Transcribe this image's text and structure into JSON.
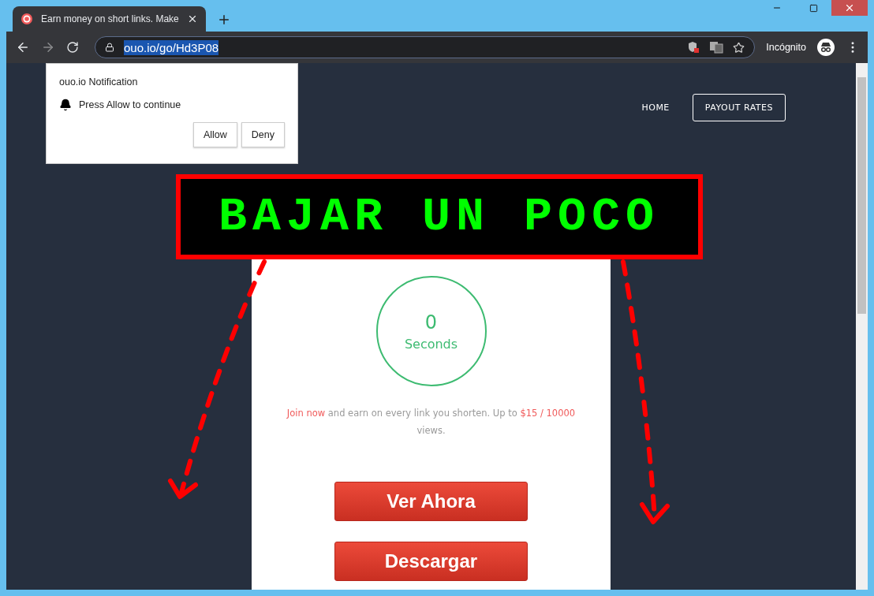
{
  "browser": {
    "tab_title": "Earn money on short links. Make",
    "address": {
      "text": "ouo.io/go/Hd3P08",
      "selected": true
    },
    "profile_label": "Incógnito"
  },
  "notification": {
    "title": "ouo.io Notification",
    "message": "Press Allow to continue",
    "buttons": [
      "Allow",
      "Deny"
    ]
  },
  "nav": [
    {
      "label": "HOME",
      "kind": "link"
    },
    {
      "label": "PAYOUT RATES",
      "kind": "outlined"
    }
  ],
  "banner": {
    "text": "BAJAR UN POCO"
  },
  "timer": {
    "count": "0",
    "unit": "Seconds"
  },
  "promo": [
    {
      "text": "Join now",
      "kind": "link"
    },
    {
      "text": " and earn on every link you shorten. Up to ",
      "kind": "plain"
    },
    {
      "text": "$15 / 10000",
      "kind": "highlight"
    },
    {
      "text": " views.",
      "kind": "plain"
    }
  ],
  "buttons": [
    "Ver Ahora",
    "Descargar"
  ]
}
